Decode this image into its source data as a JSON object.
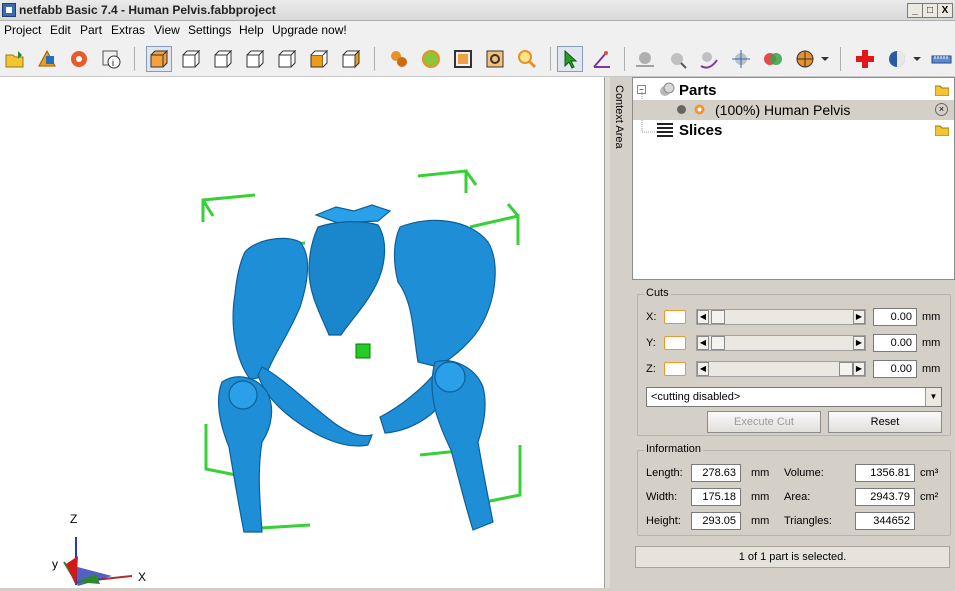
{
  "window": {
    "title": "netfabb Basic 7.4 - Human Pelvis.fabbproject",
    "minimize": "_",
    "maximize": "□",
    "close": "X"
  },
  "menu": [
    "Project",
    "Edit",
    "Part",
    "Extras",
    "View",
    "Settings",
    "Help",
    "Upgrade now!"
  ],
  "sidebar": {
    "context_label": "Context Area"
  },
  "tree": {
    "parts_label": "Parts",
    "part_item": "(100%) Human Pelvis",
    "slices_label": "Slices"
  },
  "cuts": {
    "title": "Cuts",
    "x_label": "X:",
    "y_label": "Y:",
    "z_label": "Z:",
    "x_value": "0.00",
    "y_value": "0.00",
    "z_value": "0.00",
    "unit": "mm",
    "mode": "<cutting disabled>",
    "execute_label": "Execute Cut",
    "reset_label": "Reset"
  },
  "info": {
    "title": "Information",
    "length_label": "Length:",
    "length_value": "278.63",
    "width_label": "Width:",
    "width_value": "175.18",
    "height_label": "Height:",
    "height_value": "293.05",
    "mm": "mm",
    "volume_label": "Volume:",
    "volume_value": "1356.81",
    "volume_unit": "cm³",
    "area_label": "Area:",
    "area_value": "2943.79",
    "area_unit": "cm²",
    "triangles_label": "Triangles:",
    "triangles_value": "344652"
  },
  "status": "1 of 1 part is selected.",
  "axes": {
    "z": "Z",
    "y": "y",
    "x": "X"
  },
  "colors": {
    "model": "#1e8fd6",
    "bbox": "#37d137",
    "accent": "#f0962a"
  }
}
